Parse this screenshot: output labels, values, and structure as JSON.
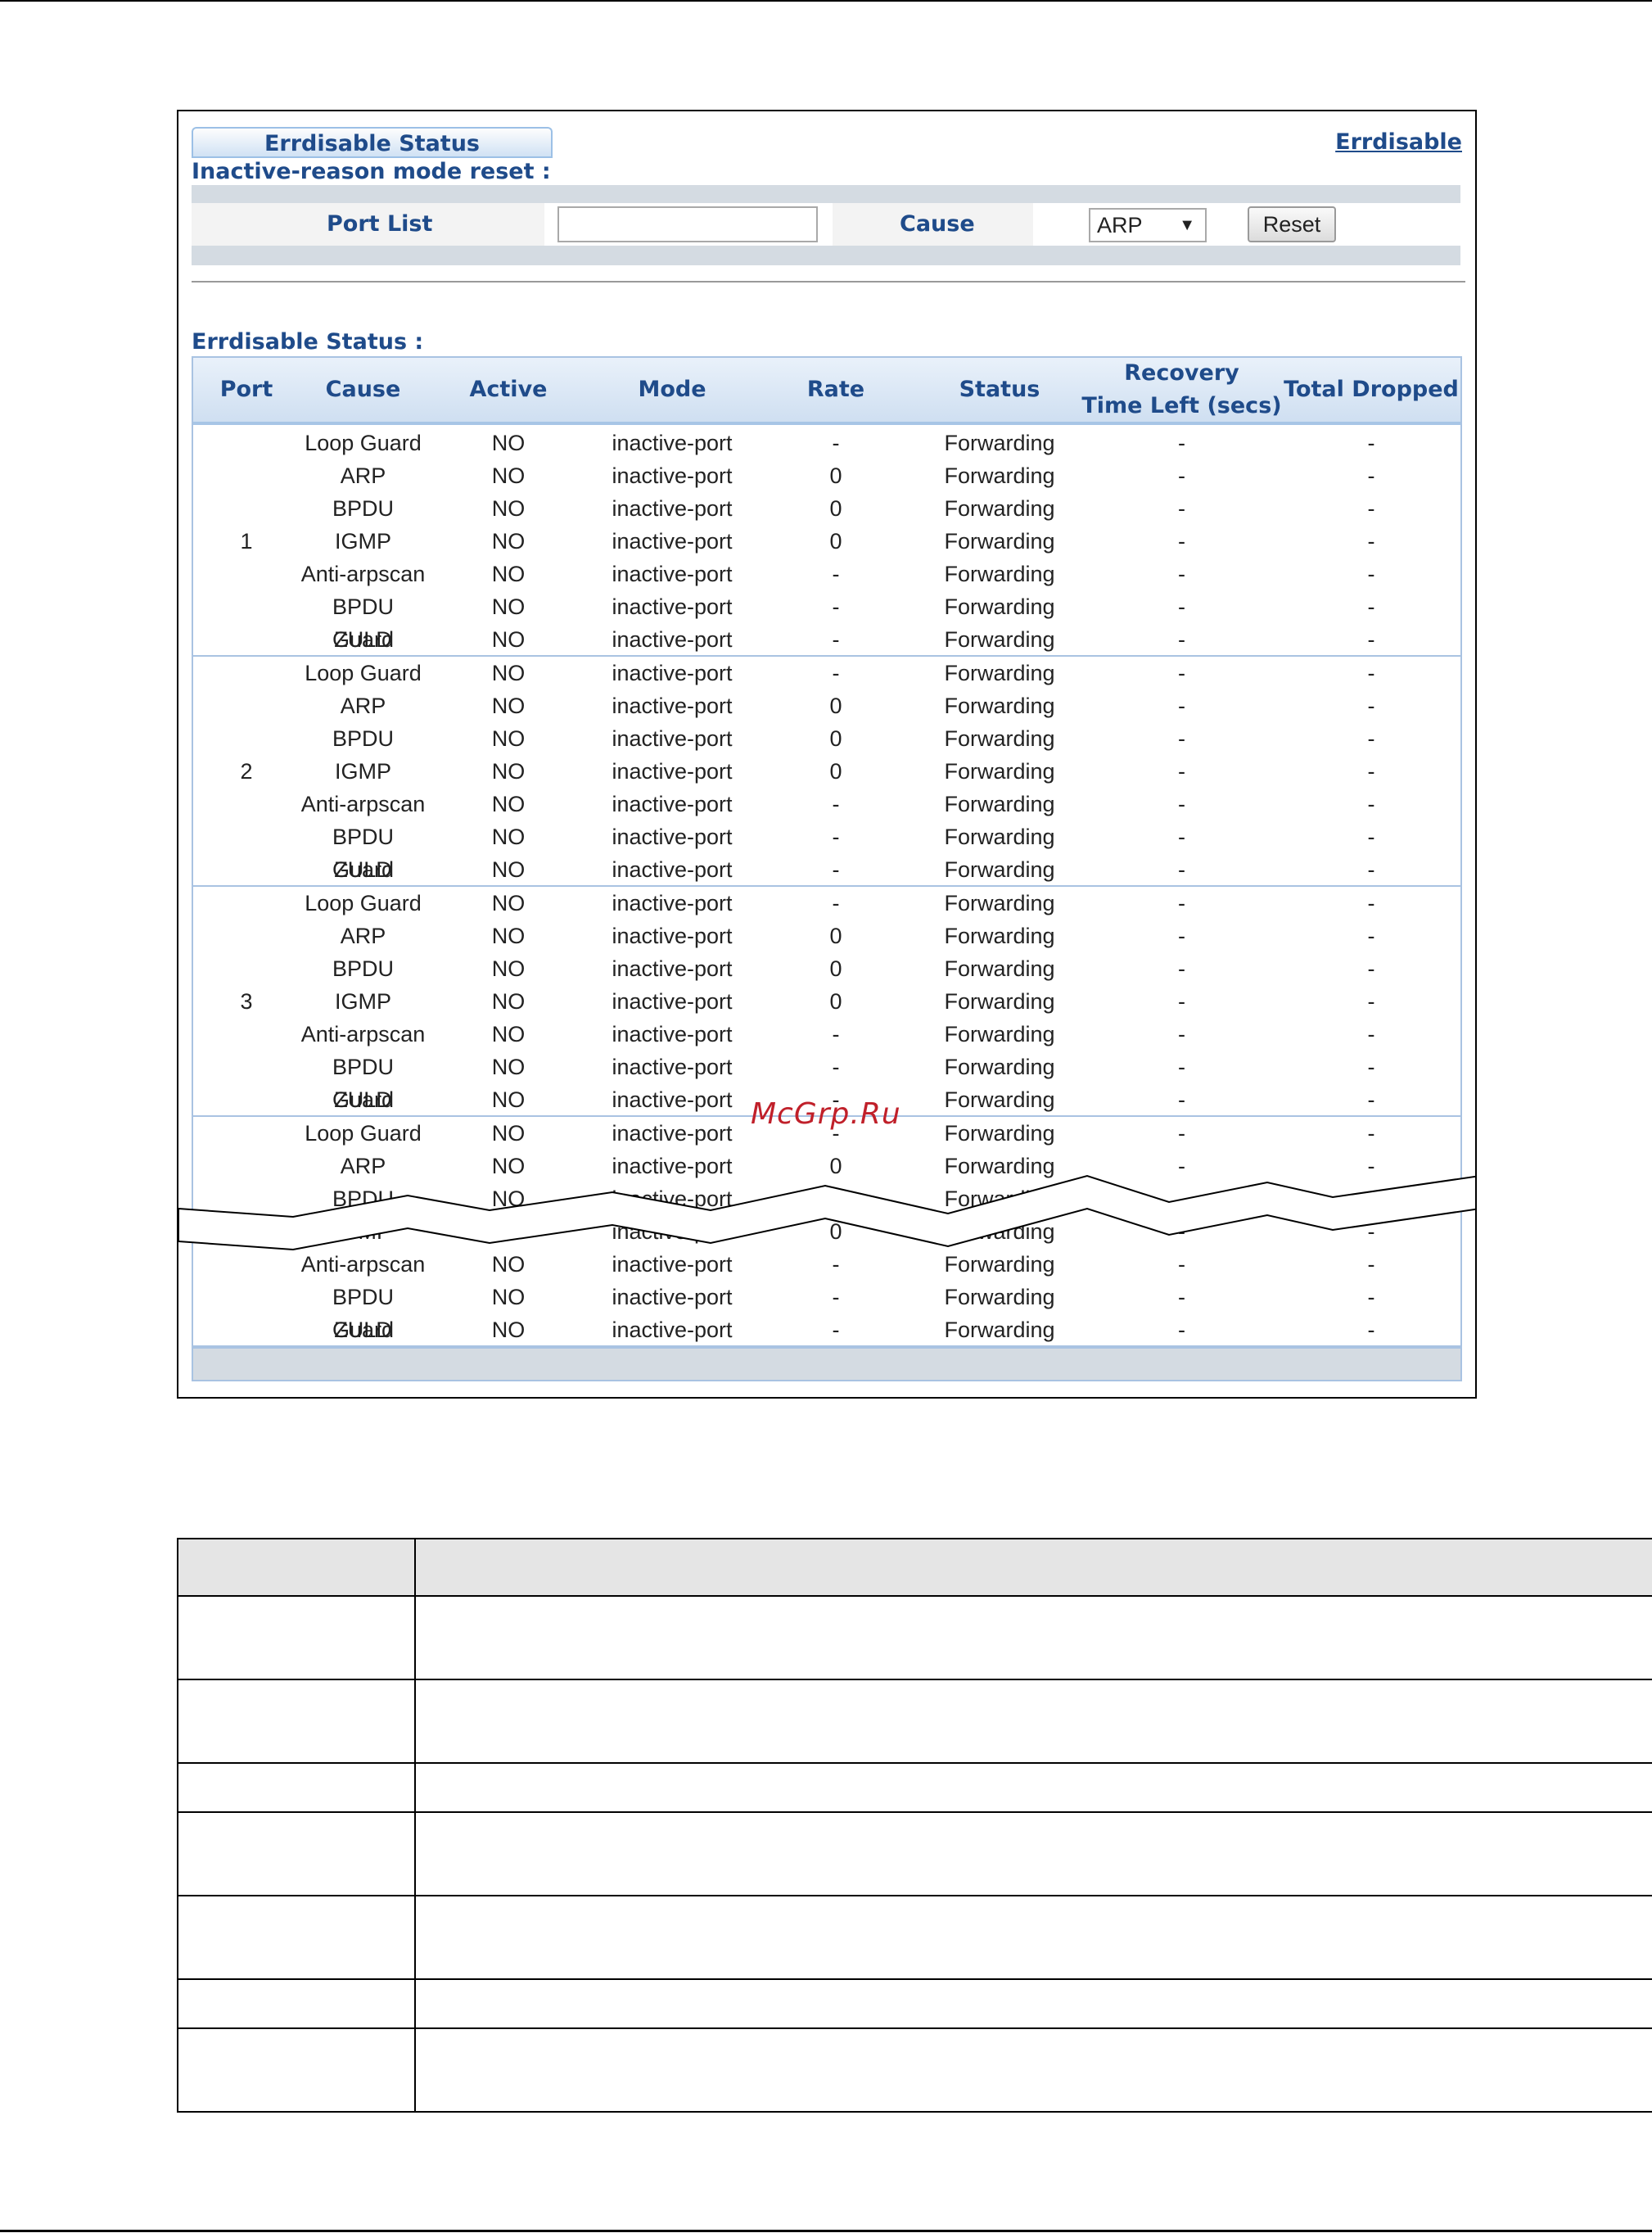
{
  "header": {
    "tab_label": "Errdisable Status",
    "top_link": "Errdisable",
    "reset_section_title": "Inactive-reason mode reset :"
  },
  "reset_form": {
    "port_list_label": "Port List",
    "port_list_value": "",
    "cause_label": "Cause",
    "cause_value": "ARP",
    "reset_button": "Reset"
  },
  "status_table": {
    "title": "Errdisable Status :",
    "columns": [
      "Port",
      "Cause",
      "Active",
      "Mode",
      "Rate",
      "Status",
      "Recovery Time Left (secs)",
      "Total Dropped"
    ],
    "column_recovery_line1": "Recovery",
    "column_recovery_line2": "Time Left (secs)",
    "groups": [
      {
        "port": "1",
        "rows": [
          [
            "Loop Guard",
            "NO",
            "inactive-port",
            "-",
            "Forwarding",
            "-",
            "-"
          ],
          [
            "ARP",
            "NO",
            "inactive-port",
            "0",
            "Forwarding",
            "-",
            "-"
          ],
          [
            "BPDU",
            "NO",
            "inactive-port",
            "0",
            "Forwarding",
            "-",
            "-"
          ],
          [
            "IGMP",
            "NO",
            "inactive-port",
            "0",
            "Forwarding",
            "-",
            "-"
          ],
          [
            "Anti-arpscan",
            "NO",
            "inactive-port",
            "-",
            "Forwarding",
            "-",
            "-"
          ],
          [
            "BPDU Guard",
            "NO",
            "inactive-port",
            "-",
            "Forwarding",
            "-",
            "-"
          ],
          [
            "ZULD",
            "NO",
            "inactive-port",
            "-",
            "Forwarding",
            "-",
            "-"
          ]
        ]
      },
      {
        "port": "2",
        "rows": [
          [
            "Loop Guard",
            "NO",
            "inactive-port",
            "-",
            "Forwarding",
            "-",
            "-"
          ],
          [
            "ARP",
            "NO",
            "inactive-port",
            "0",
            "Forwarding",
            "-",
            "-"
          ],
          [
            "BPDU",
            "NO",
            "inactive-port",
            "0",
            "Forwarding",
            "-",
            "-"
          ],
          [
            "IGMP",
            "NO",
            "inactive-port",
            "0",
            "Forwarding",
            "-",
            "-"
          ],
          [
            "Anti-arpscan",
            "NO",
            "inactive-port",
            "-",
            "Forwarding",
            "-",
            "-"
          ],
          [
            "BPDU Guard",
            "NO",
            "inactive-port",
            "-",
            "Forwarding",
            "-",
            "-"
          ],
          [
            "ZULD",
            "NO",
            "inactive-port",
            "-",
            "Forwarding",
            "-",
            "-"
          ]
        ]
      },
      {
        "port": "3",
        "rows": [
          [
            "Loop Guard",
            "NO",
            "inactive-port",
            "-",
            "Forwarding",
            "-",
            "-"
          ],
          [
            "ARP",
            "NO",
            "inactive-port",
            "0",
            "Forwarding",
            "-",
            "-"
          ],
          [
            "BPDU",
            "NO",
            "inactive-port",
            "0",
            "Forwarding",
            "-",
            "-"
          ],
          [
            "IGMP",
            "NO",
            "inactive-port",
            "0",
            "Forwarding",
            "-",
            "-"
          ],
          [
            "Anti-arpscan",
            "NO",
            "inactive-port",
            "-",
            "Forwarding",
            "-",
            "-"
          ],
          [
            "BPDU Guard",
            "NO",
            "inactive-port",
            "-",
            "Forwarding",
            "-",
            "-"
          ],
          [
            "ZULD",
            "NO",
            "inactive-port",
            "-",
            "Forwarding",
            "-",
            "-"
          ]
        ]
      },
      {
        "port": "",
        "rows": [
          [
            "Loop Guard",
            "NO",
            "inactive-port",
            "-",
            "Forwarding",
            "-",
            "-"
          ],
          [
            "ARP",
            "NO",
            "inactive-port",
            "0",
            "Forwarding",
            "-",
            "-"
          ],
          [
            "BPDU",
            "NO",
            "inactive-port",
            "0",
            "Forwarding",
            "-",
            "-"
          ],
          [
            "IGMP",
            "NO",
            "inactive-port",
            "0",
            "Forwarding",
            "-",
            "-"
          ],
          [
            "Anti-arpscan",
            "NO",
            "inactive-port",
            "-",
            "Forwarding",
            "-",
            "-"
          ],
          [
            "BPDU Guard",
            "NO",
            "inactive-port",
            "-",
            "Forwarding",
            "-",
            "-"
          ],
          [
            "ZULD",
            "NO",
            "inactive-port",
            "-",
            "Forwarding",
            "-",
            "-"
          ]
        ]
      }
    ]
  },
  "watermark": "McGrp.Ru"
}
